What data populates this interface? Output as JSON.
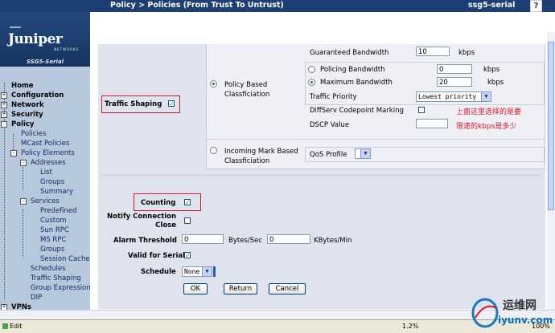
{
  "header": {
    "breadcrumb": "Policy > Policies (From Trust To Untrust)",
    "device": "ssg5-serial",
    "help_icon": "?"
  },
  "logo": {
    "brand": "Juniper",
    "sub": "NETWORKS",
    "model": "SSG5-Serial"
  },
  "nav": {
    "home": "Home",
    "configuration": "Configuration",
    "network": "Network",
    "security": "Security",
    "policy": "Policy",
    "policies": "Policies",
    "mcast_policies": "MCast Policies",
    "policy_elements": "Policy Elements",
    "addresses": "Addresses",
    "list": "List",
    "groups": "Groups",
    "summary": "Summary",
    "services": "Services",
    "predefined": "Predefined",
    "custom": "Custom",
    "sun_rpc": "Sun RPC",
    "ms_rpc": "MS RPC",
    "svc_groups": "Groups",
    "session_cache": "Session Cache",
    "schedules": "Schedules",
    "traffic_shaping": "Traffic Shaping",
    "group_expression": "Group Expression",
    "dip": "DIP",
    "vpns": "VPNs"
  },
  "form": {
    "traffic_shaping_label": "Traffic Shaping",
    "traffic_shaping_checked": true,
    "policy_based_label": "Policy Based Classficiation",
    "guaranteed_label": "Guaranteed Bandwidth",
    "guaranteed_value": "10",
    "kbps": "kbps",
    "policing_label": "Policing Bandwidth",
    "policing_value": "0",
    "maximum_label": "Maximum Bandwidth",
    "maximum_value": "20",
    "traffic_priority_label": "Traffic Priority",
    "traffic_priority_value": "Lowest priority",
    "diffserv_label": "DiffServ Codepoint Marking",
    "dscp_label": "DSCP Value",
    "dscp_value": "",
    "incoming_label": "Incoming Mark Based Classficiation",
    "qos_label": "QoS Profile",
    "counting_label": "Counting",
    "notify_label": "Notify Connection Close",
    "alarm_label": "Alarm Threshold",
    "alarm_bytes_value": "0",
    "bytes_sec": "Bytes/Sec",
    "alarm_kbytes_value": "0",
    "kbytes_min": "KBytes/Min",
    "valid_serial_label": "Valid for Serial",
    "schedule_label": "Schedule",
    "schedule_value": "None",
    "ok": "OK",
    "return": "Return",
    "cancel": "Cancel"
  },
  "annotations": {
    "note1": "上面这里选择的是要",
    "note2": "限速的kbps是多少"
  },
  "status": {
    "text": "Edit",
    "zoom": "1.2%",
    "percent": "100%"
  },
  "watermark": {
    "line1": "运维网",
    "line2": "iyunv.com"
  },
  "colors": {
    "header": "#1e3f73",
    "sidebar": "#b7c8dd",
    "content": "#dfe3ed",
    "highlight": "#e0182f"
  }
}
